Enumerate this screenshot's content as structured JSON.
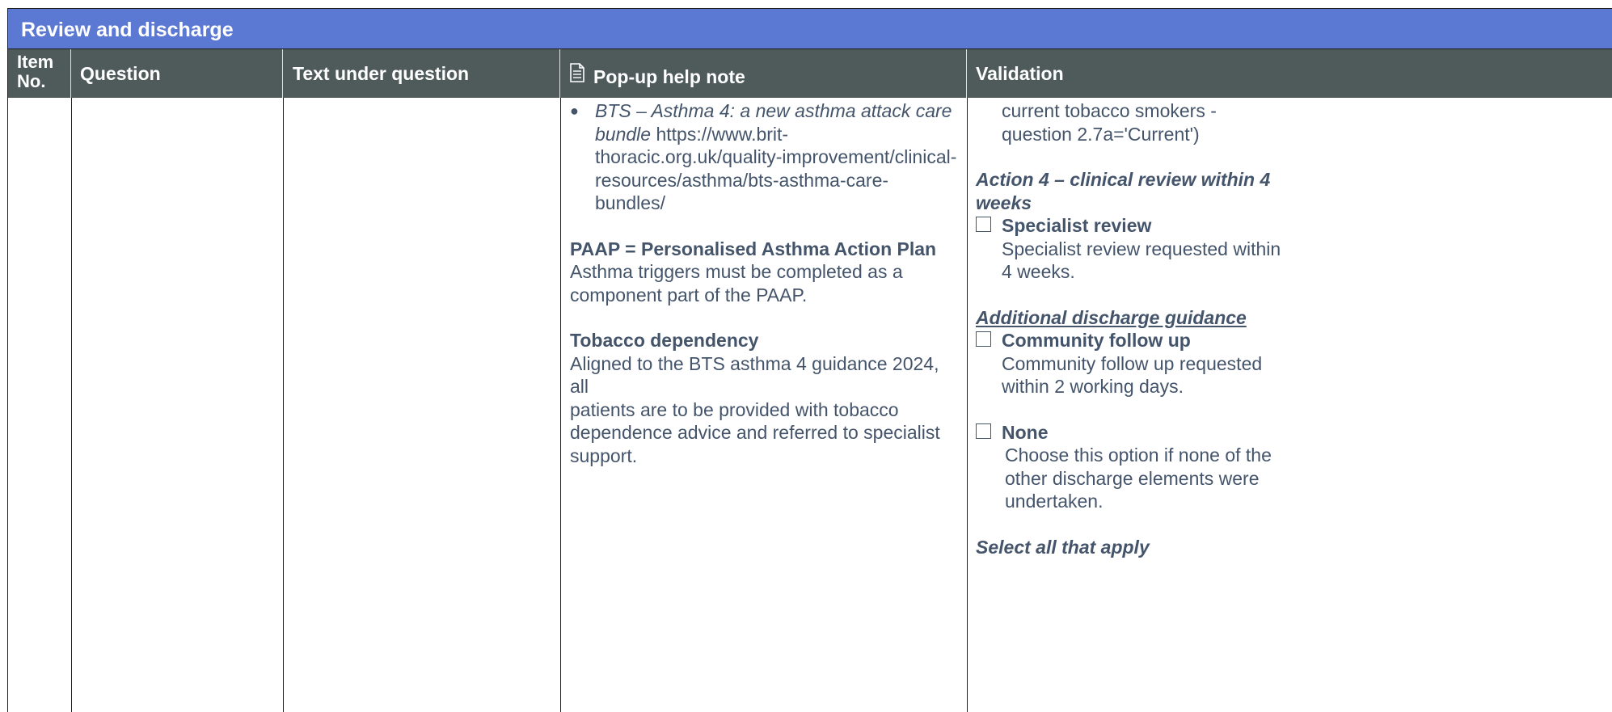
{
  "title": "Review and discharge",
  "headers": {
    "item_no_line1": "Item",
    "item_no_line2": "No.",
    "question": "Question",
    "text_under_question": "Text under question",
    "help_note_icon": "document-icon",
    "help_note": "Pop-up help note",
    "validation": "Validation"
  },
  "help_note": {
    "bullet_ref_italic": "BTS – Asthma 4: a new asthma attack care bundle",
    "bullet_ref_url_1": "https://www.brit-",
    "bullet_ref_url_2": "thoracic.org.uk/quality-improvement/clinical-",
    "bullet_ref_url_3": "resources/asthma/bts-asthma-care-bundles/",
    "paap_heading": "PAAP = Personalised Asthma Action Plan",
    "paap_line1": "Asthma triggers must be completed as a",
    "paap_line2": "component part of the PAAP.",
    "tobacco_heading": "Tobacco dependency",
    "tobacco_line1": "Aligned to the BTS asthma 4 guidance 2024, all",
    "tobacco_line2": "patients are to be provided with tobacco",
    "tobacco_line3": "dependence advice and referred to specialist",
    "tobacco_line4": "support."
  },
  "validation": {
    "cont_line1": "current tobacco smokers -",
    "cont_line2": "question 2.7a='Current')",
    "action4_line1": "Action 4 – clinical review within 4",
    "action4_line2": "weeks",
    "specialist_label": "Specialist review",
    "specialist_desc1": "Specialist review requested within",
    "specialist_desc2": "4 weeks.",
    "additional_heading": "Additional discharge guidance",
    "community_label": "Community follow up",
    "community_desc1": "Community follow up requested",
    "community_desc2": "within 2 working days.",
    "none_label": "None",
    "none_desc1": "Choose this option if none of the",
    "none_desc2": "other discharge elements were",
    "none_desc3": "undertaken.",
    "select_all": "Select all that apply"
  }
}
